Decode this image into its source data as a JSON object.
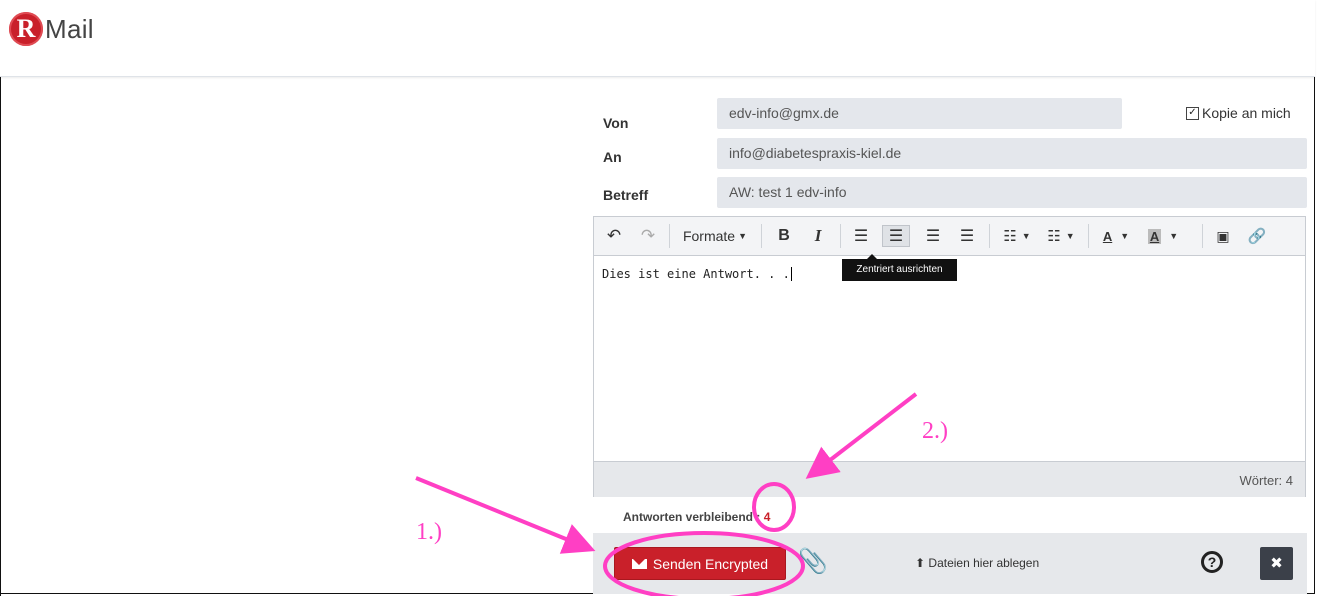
{
  "app": {
    "logo_letter": "R",
    "logo_text": "Mail"
  },
  "form": {
    "from_label": "Von",
    "from_value": "edv-info@gmx.de",
    "to_label": "An",
    "to_value": "info@diabetespraxis-kiel.de",
    "subject_label": "Betreff",
    "subject_value": "AW: test 1 edv-info",
    "copy_to_me_label": "Kopie an mich",
    "copy_to_me_checked": true
  },
  "toolbar": {
    "formats_label": "Formate",
    "bold": "B",
    "italic": "I",
    "tooltip": "Zentriert ausrichten"
  },
  "editor": {
    "content": "Dies ist eine Antwort. . .",
    "word_count": "Wörter: 4"
  },
  "footer": {
    "remaining_label": "Antworten verbleibend :",
    "remaining_count": "4",
    "send_label": "Senden Encrypted",
    "drop_label": "Dateien hier ablegen",
    "help_glyph": "?",
    "close_glyph": "✖"
  },
  "annotations": {
    "step1": "1.)",
    "step2": "2.)",
    "color": "#ff3fc4"
  },
  "colors": {
    "accent": "#c9202a",
    "dark_button": "#3b4049"
  }
}
